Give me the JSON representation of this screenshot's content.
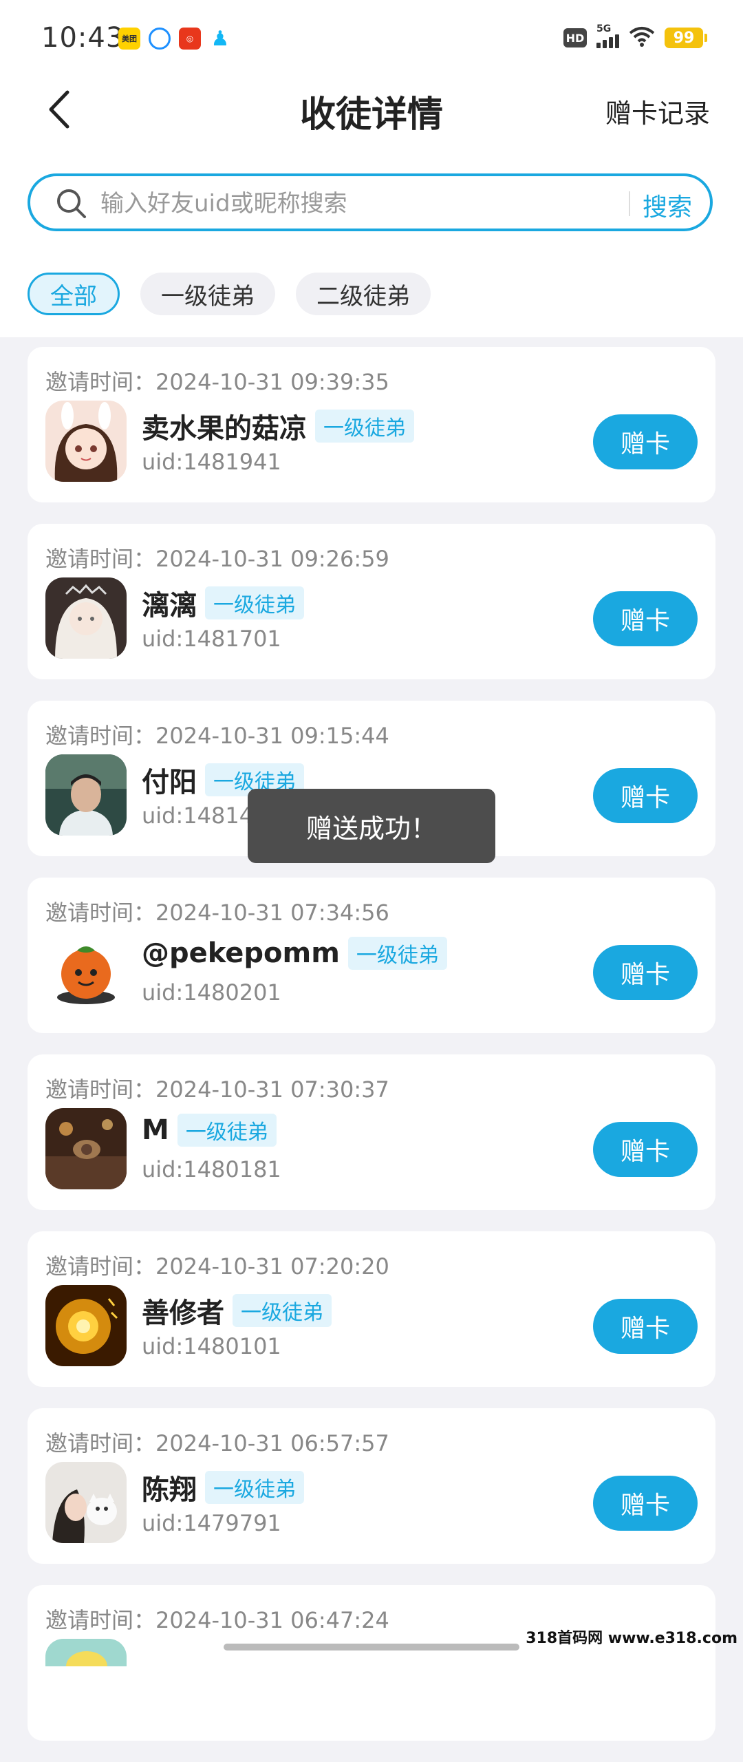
{
  "status_bar": {
    "time": "10:43",
    "apps": [
      {
        "name": "meituan-icon",
        "label": "美团",
        "color": "#ffd100"
      },
      {
        "name": "browser-icon",
        "label": "",
        "color": "#1e90ff"
      },
      {
        "name": "pinduoduo-icon",
        "label": "",
        "color": "#e8371c"
      },
      {
        "name": "qq-icon",
        "label": "",
        "color": "#12b7f5"
      }
    ],
    "hd": "HD",
    "network": "5G",
    "battery": "99"
  },
  "header": {
    "title": "收徒详情",
    "record_link": "赠卡记录"
  },
  "search": {
    "placeholder": "输入好友uid或昵称搜索",
    "button": "搜索"
  },
  "filters": [
    {
      "label": "全部",
      "active": true
    },
    {
      "label": "一级徒弟",
      "active": false
    },
    {
      "label": "二级徒弟",
      "active": false
    }
  ],
  "invite_prefix": "邀请时间：",
  "list": [
    {
      "time": "邀请时间：2024-10-31 09:39:35",
      "name": "卖水果的菇凉",
      "tag": "一级徒弟",
      "uid": "uid:1481941",
      "action": "赠卡"
    },
    {
      "time": "邀请时间：2024-10-31 09:26:59",
      "name": "漓漓",
      "tag": "一级徒弟",
      "uid": "uid:1481701",
      "action": "赠卡"
    },
    {
      "time": "邀请时间：2024-10-31 09:15:44",
      "name": "付阳",
      "tag": "一级徒弟",
      "uid": "uid:1481491",
      "action": "赠卡"
    },
    {
      "time": "邀请时间：2024-10-31 07:34:56",
      "name": "@pekepomm",
      "tag": "一级徒弟",
      "uid": "uid:1480201",
      "action": "赠卡"
    },
    {
      "time": "邀请时间：2024-10-31 07:30:37",
      "name": "M",
      "tag": "一级徒弟",
      "uid": "uid:1480181",
      "action": "赠卡"
    },
    {
      "time": "邀请时间：2024-10-31 07:20:20",
      "name": "善修者",
      "tag": "一级徒弟",
      "uid": "uid:1480101",
      "action": "赠卡"
    },
    {
      "time": "邀请时间：2024-10-31 06:57:57",
      "name": "陈翔",
      "tag": "一级徒弟",
      "uid": "uid:1479791",
      "action": "赠卡"
    },
    {
      "time": "邀请时间：2024-10-31 06:47:24",
      "name": "",
      "tag": "",
      "uid": "",
      "action": ""
    }
  ],
  "toast": "赠送成功！",
  "watermark": "318首码网 www.e318.com"
}
